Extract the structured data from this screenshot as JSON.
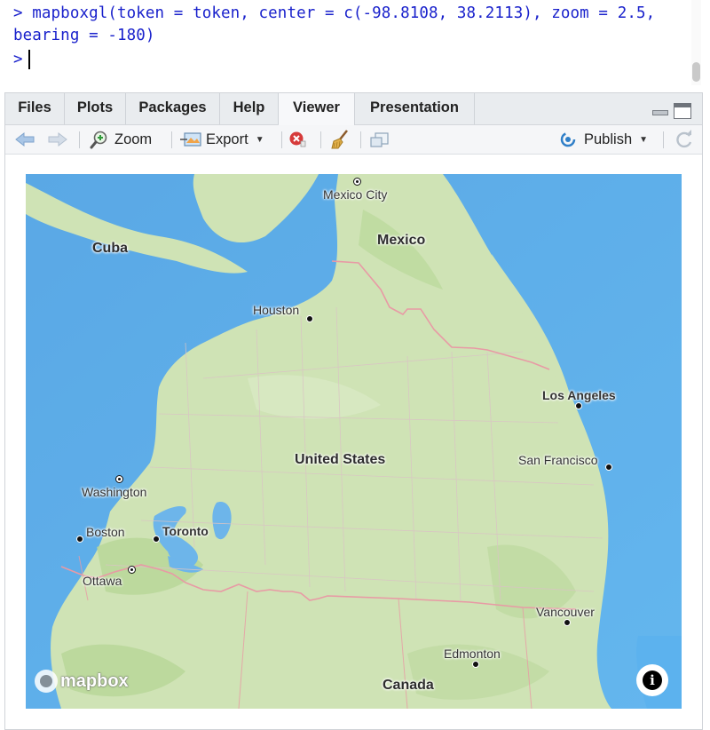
{
  "console": {
    "line1": "> mapboxgl(token = token, center = c(-98.8108, 38.2113), zoom = 2.5,",
    "line2": "bearing = -180)",
    "prompt": ">"
  },
  "tabs": [
    "Files",
    "Plots",
    "Packages",
    "Help",
    "Viewer",
    "Presentation"
  ],
  "active_tab": "Viewer",
  "toolbar": {
    "zoom_label": "Zoom",
    "export_label": "Export",
    "publish_label": "Publish"
  },
  "icons": {
    "back": "arrow-left-icon",
    "forward": "arrow-right-icon",
    "zoom": "magnifier-icon",
    "export": "export-icon",
    "remove": "remove-icon",
    "clear": "broom-icon",
    "popout": "popout-icon",
    "publish": "publish-icon",
    "refresh": "refresh-icon"
  },
  "map": {
    "labels": {
      "mexico_city": "Mexico City",
      "mexico": "Mexico",
      "cuba": "Cuba",
      "houston": "Houston",
      "los_angeles": "Los Angeles",
      "united_states": "United States",
      "san_francisco": "San Francisco",
      "washington": "Washington",
      "boston": "Boston",
      "toronto": "Toronto",
      "ottawa": "Ottawa",
      "vancouver": "Vancouver",
      "edmonton": "Edmonton",
      "canada": "Canada"
    },
    "attribution_logo": "mapbox",
    "info_label": "i",
    "colors": {
      "water": "#62b0e8",
      "water_deep": "#4c9fe0",
      "land": "#cfe3b5",
      "land_dark": "#b9d99b",
      "border": "#e89aa5"
    }
  }
}
